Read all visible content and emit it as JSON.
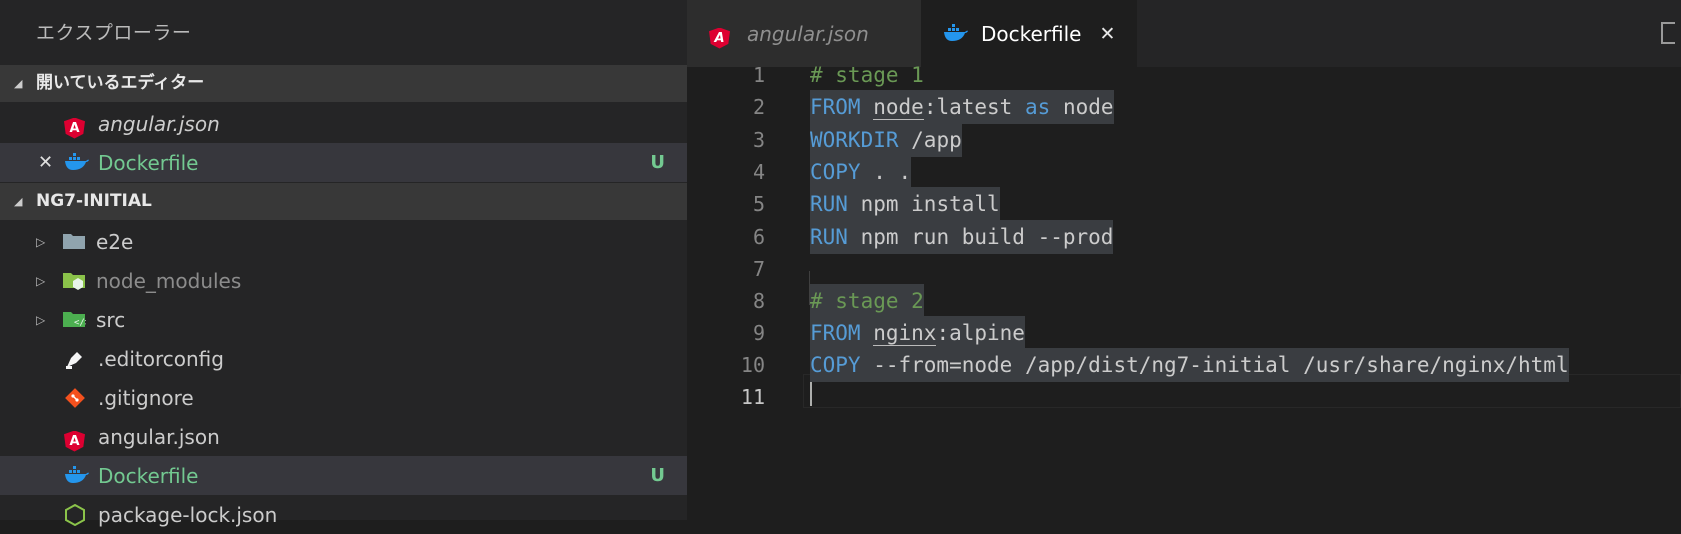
{
  "sidebar": {
    "title": "エクスプローラー",
    "open_editors": {
      "header": "開いているエディター",
      "items": [
        {
          "label": "angular.json",
          "git": ""
        },
        {
          "label": "Dockerfile",
          "git": "U"
        }
      ]
    },
    "project": {
      "header": "NG7-INITIAL",
      "items": [
        {
          "label": "e2e",
          "git": ""
        },
        {
          "label": "node_modules",
          "git": ""
        },
        {
          "label": "src",
          "git": ""
        },
        {
          "label": ".editorconfig",
          "git": ""
        },
        {
          "label": ".gitignore",
          "git": ""
        },
        {
          "label": "angular.json",
          "git": ""
        },
        {
          "label": "Dockerfile",
          "git": "U"
        },
        {
          "label": "package-lock.json",
          "git": ""
        }
      ]
    }
  },
  "editor": {
    "tabs": [
      {
        "label": "angular.json",
        "active": false
      },
      {
        "label": "Dockerfile",
        "active": true
      }
    ],
    "line_numbers": [
      "1",
      "2",
      "3",
      "4",
      "5",
      "6",
      "7",
      "8",
      "9",
      "10",
      "11"
    ],
    "code": {
      "l1": "# stage 1",
      "l2": {
        "kw1": "FROM",
        "image": "node",
        "rest": ":latest",
        "kw2": "as",
        "name": "node"
      },
      "l3": {
        "kw": "WORKDIR",
        "rest": " /app"
      },
      "l4": {
        "kw": "COPY",
        "rest": " . ."
      },
      "l5": {
        "kw": "RUN",
        "rest": " npm install"
      },
      "l6": {
        "kw": "RUN",
        "rest": " npm run build --prod"
      },
      "l8": "# stage 2",
      "l9": {
        "kw": "FROM",
        "image": "nginx",
        "rest": ":alpine"
      },
      "l10": {
        "kw": "COPY",
        "rest": " --from=node /app/dist/ng7-initial /usr/share/nginx/html"
      }
    }
  },
  "colors": {
    "keyword": "#569cd6",
    "comment": "#6a9955",
    "git_untracked": "#73c991",
    "angular_red": "#dd0031",
    "docker_blue": "#2496ed"
  },
  "icons": {
    "angular": "angular-icon",
    "docker": "docker-whale-icon",
    "folder": "folder-icon",
    "node_folder": "node-folder-icon",
    "src_folder": "src-folder-icon",
    "editorconfig": "editorconfig-icon",
    "git": "git-icon",
    "npm": "nodejs-icon"
  }
}
